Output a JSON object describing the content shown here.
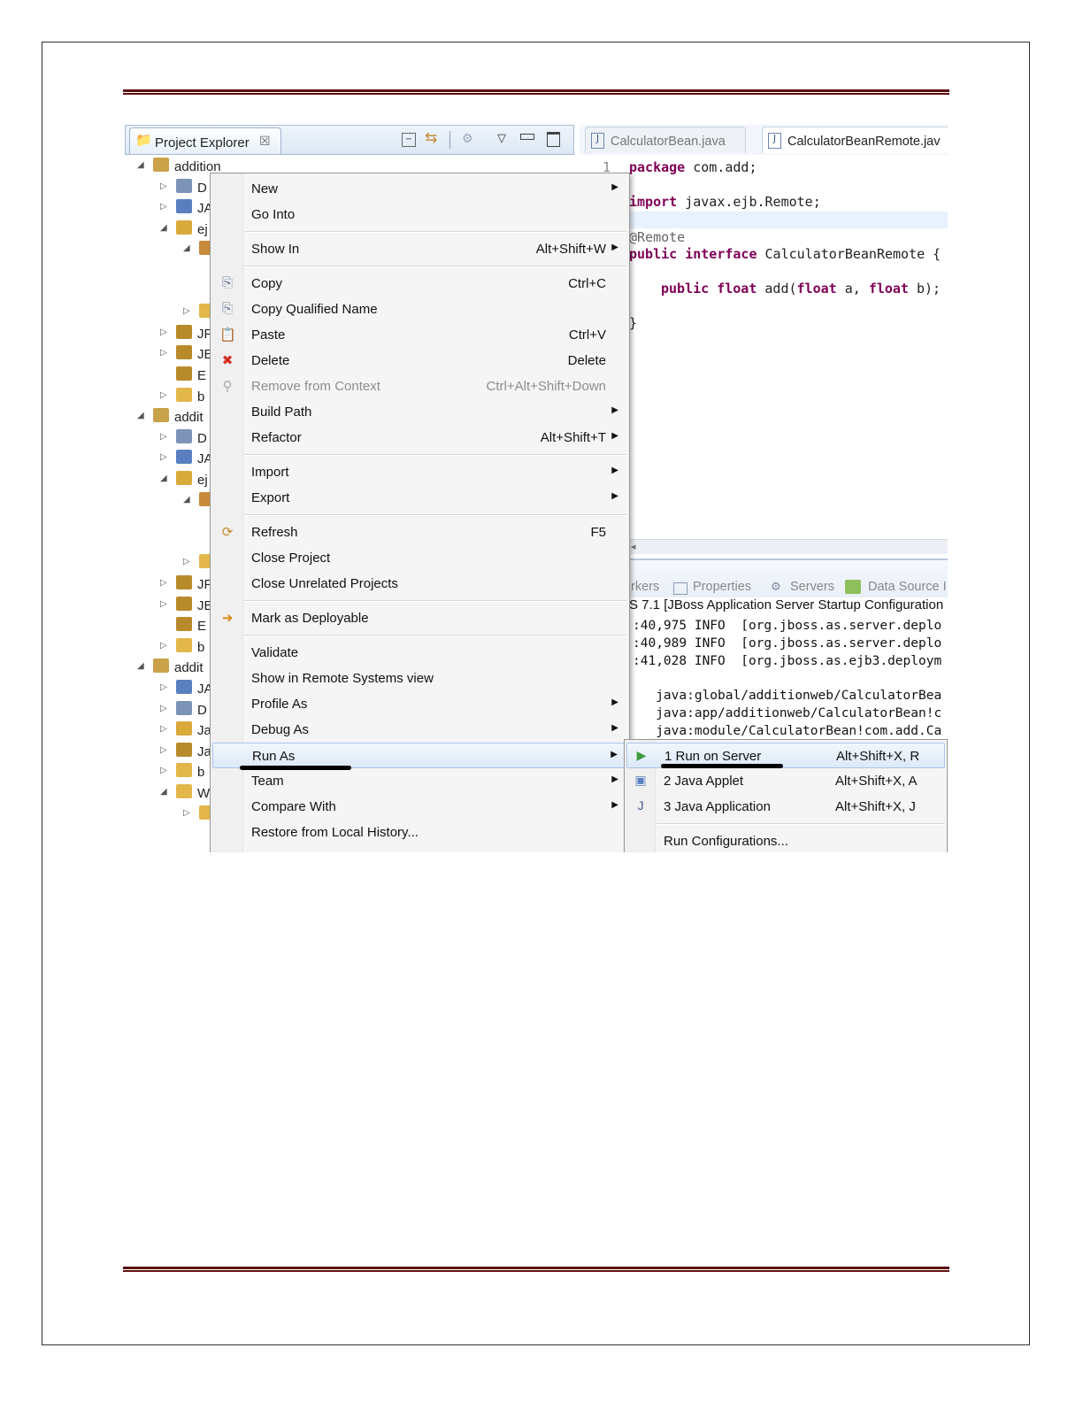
{
  "project_explorer": {
    "title": "Project Explorer",
    "close_glyph": "☒",
    "toolbar_icons": [
      "collapse-all-icon",
      "link-with-editor-icon",
      "filter-icon",
      "view-menu-icon",
      "minimize-icon",
      "maximize-icon"
    ]
  },
  "tree": [
    {
      "arrow": "◢",
      "label": "addition",
      "icon": "ejb-project-icon",
      "color": "#c9a24a",
      "indent": 0
    },
    {
      "arrow": "▷",
      "label": "D",
      "icon": "deployment-descriptor-icon",
      "color": "#7d93b8",
      "indent": 1
    },
    {
      "arrow": "▷",
      "label": "JA",
      "icon": "jax-ws-icon",
      "color": "#5a7fc0",
      "indent": 1
    },
    {
      "arrow": "◢",
      "label": "ej",
      "icon": "ejb-module-icon",
      "color": "#d9a93a",
      "indent": 1
    },
    {
      "arrow": "◢",
      "label": "",
      "icon": "package-icon",
      "color": "#c88a3a",
      "indent": 2
    },
    {
      "arrow": "",
      "label": "",
      "icon": "",
      "color": "",
      "indent": 3
    },
    {
      "arrow": "",
      "label": "",
      "icon": "",
      "color": "",
      "indent": 3
    },
    {
      "arrow": "▷",
      "label": "",
      "icon": "folder-icon",
      "color": "#e3b74a",
      "indent": 2
    },
    {
      "arrow": "▷",
      "label": "JF",
      "icon": "library-icon",
      "color": "#b88a2a",
      "indent": 1
    },
    {
      "arrow": "▷",
      "label": "JE",
      "icon": "library-icon",
      "color": "#b88a2a",
      "indent": 1
    },
    {
      "arrow": "",
      "label": "E",
      "icon": "library-icon",
      "color": "#b88a2a",
      "indent": 1
    },
    {
      "arrow": "▷",
      "label": "b",
      "icon": "folder-icon",
      "color": "#e3b74a",
      "indent": 1
    },
    {
      "arrow": "◢",
      "label": "addit",
      "icon": "ejb-project-icon",
      "color": "#c9a24a",
      "indent": 0
    },
    {
      "arrow": "▷",
      "label": "D",
      "icon": "deployment-descriptor-icon",
      "color": "#7d93b8",
      "indent": 1
    },
    {
      "arrow": "▷",
      "label": "JA",
      "icon": "jax-ws-icon",
      "color": "#5a7fc0",
      "indent": 1
    },
    {
      "arrow": "◢",
      "label": "ej",
      "icon": "ejb-module-icon",
      "color": "#d9a93a",
      "indent": 1
    },
    {
      "arrow": "◢",
      "label": "",
      "icon": "package-icon",
      "color": "#c88a3a",
      "indent": 2
    },
    {
      "arrow": "",
      "label": "",
      "icon": "",
      "color": "",
      "indent": 3
    },
    {
      "arrow": "",
      "label": "",
      "icon": "",
      "color": "",
      "indent": 3
    },
    {
      "arrow": "▷",
      "label": "",
      "icon": "folder-icon",
      "color": "#e3b74a",
      "indent": 2
    },
    {
      "arrow": "▷",
      "label": "JF",
      "icon": "library-icon",
      "color": "#b88a2a",
      "indent": 1
    },
    {
      "arrow": "▷",
      "label": "JE",
      "icon": "library-icon",
      "color": "#b88a2a",
      "indent": 1
    },
    {
      "arrow": "",
      "label": "E",
      "icon": "library-icon",
      "color": "#b88a2a",
      "indent": 1
    },
    {
      "arrow": "▷",
      "label": "b",
      "icon": "folder-icon",
      "color": "#e3b74a",
      "indent": 1
    },
    {
      "arrow": "◢",
      "label": "addit",
      "icon": "web-project-icon",
      "color": "#c9a24a",
      "indent": 0
    },
    {
      "arrow": "▷",
      "label": "JA",
      "icon": "jax-ws-icon",
      "color": "#5a7fc0",
      "indent": 1
    },
    {
      "arrow": "▷",
      "label": "D",
      "icon": "deployment-descriptor-icon",
      "color": "#7d93b8",
      "indent": 1
    },
    {
      "arrow": "▷",
      "label": "Ja",
      "icon": "java-resources-icon",
      "color": "#d9a93a",
      "indent": 1
    },
    {
      "arrow": "▷",
      "label": "Ja",
      "icon": "library-icon",
      "color": "#b88a2a",
      "indent": 1
    },
    {
      "arrow": "▷",
      "label": "b",
      "icon": "folder-icon",
      "color": "#e3b74a",
      "indent": 1
    },
    {
      "arrow": "◢",
      "label": "W",
      "icon": "folder-icon",
      "color": "#e3b74a",
      "indent": 1
    },
    {
      "arrow": "▷",
      "label": "",
      "icon": "folder-icon",
      "color": "#e3b74a",
      "indent": 2
    }
  ],
  "editor": {
    "tabs": [
      {
        "label": "CalculatorBean.java",
        "icon": "java-file-icon",
        "active": false
      },
      {
        "label": "CalculatorBeanRemote.jav",
        "icon": "java-file-icon",
        "active": true
      }
    ],
    "line_number": "1",
    "lines": [
      {
        "kw": "package",
        "rest": " com.add;"
      },
      {
        "kw": "import",
        "rest": " javax.ejb.Remote;"
      },
      {
        "ann": "@Remote",
        "rest": ""
      },
      {
        "kw": "public interface",
        "rest": " CalculatorBeanRemote {"
      },
      {
        "kw": "public float",
        "rest": " add(",
        "kw2": "float",
        "rest2": " a, ",
        "kw3": "float",
        "rest3": " b);"
      },
      {
        "rest": "}"
      }
    ]
  },
  "scroll_marker": "◂",
  "console": {
    "tabs": [
      "rkers",
      "Properties",
      "Servers",
      "Data Source I"
    ],
    "title": "S 7.1 [JBoss Application Server Startup Configuration",
    "lines": [
      ":40,975 INFO  [org.jboss.as.server.deplo",
      ":40,989 INFO  [org.jboss.as.server.deplo",
      ":41,028 INFO  [org.jboss.as.ejb3.deploym",
      "",
      "   java:global/additionweb/CalculatorBea",
      "   java:app/additionweb/CalculatorBean!c",
      "   java:module/CalculatorBean!com.add.Ca"
    ]
  },
  "context_menu": {
    "items": [
      {
        "label": "New",
        "shortcut": "",
        "submenu": true,
        "icon": "",
        "disabled": false
      },
      {
        "label": "Go Into",
        "shortcut": "",
        "submenu": false,
        "icon": "",
        "disabled": false
      },
      {
        "sep": true
      },
      {
        "label": "Show In",
        "shortcut": "Alt+Shift+W",
        "submenu": true,
        "icon": "",
        "disabled": false
      },
      {
        "sep": true
      },
      {
        "label": "Copy",
        "shortcut": "Ctrl+C",
        "submenu": false,
        "icon": "copy-icon",
        "disabled": false
      },
      {
        "label": "Copy Qualified Name",
        "shortcut": "",
        "submenu": false,
        "icon": "copy-qualified-name-icon",
        "disabled": false
      },
      {
        "label": "Paste",
        "shortcut": "Ctrl+V",
        "submenu": false,
        "icon": "paste-icon",
        "disabled": false
      },
      {
        "label": "Delete",
        "shortcut": "Delete",
        "submenu": false,
        "icon": "delete-icon",
        "disabled": false
      },
      {
        "label": "Remove from Context",
        "shortcut": "Ctrl+Alt+Shift+Down",
        "submenu": false,
        "icon": "remove-context-icon",
        "disabled": true
      },
      {
        "label": "Build Path",
        "shortcut": "",
        "submenu": true,
        "icon": "",
        "disabled": false
      },
      {
        "label": "Refactor",
        "shortcut": "Alt+Shift+T",
        "submenu": true,
        "icon": "",
        "disabled": false
      },
      {
        "sep": true
      },
      {
        "label": "Import",
        "shortcut": "",
        "submenu": true,
        "icon": "",
        "disabled": false
      },
      {
        "label": "Export",
        "shortcut": "",
        "submenu": true,
        "icon": "",
        "disabled": false
      },
      {
        "sep": true
      },
      {
        "label": "Refresh",
        "shortcut": "F5",
        "submenu": false,
        "icon": "refresh-icon",
        "disabled": false
      },
      {
        "label": "Close Project",
        "shortcut": "",
        "submenu": false,
        "icon": "",
        "disabled": false
      },
      {
        "label": "Close Unrelated Projects",
        "shortcut": "",
        "submenu": false,
        "icon": "",
        "disabled": false
      },
      {
        "sep": true
      },
      {
        "label": "Mark as Deployable",
        "shortcut": "",
        "submenu": false,
        "icon": "deployable-icon",
        "disabled": false
      },
      {
        "sep": true
      },
      {
        "label": "Validate",
        "shortcut": "",
        "submenu": false,
        "icon": "",
        "disabled": false
      },
      {
        "label": "Show in Remote Systems view",
        "shortcut": "",
        "submenu": false,
        "icon": "",
        "disabled": false
      },
      {
        "label": "Profile As",
        "shortcut": "",
        "submenu": true,
        "icon": "",
        "disabled": false
      },
      {
        "label": "Debug As",
        "shortcut": "",
        "submenu": true,
        "icon": "",
        "disabled": false
      },
      {
        "label": "Run As",
        "shortcut": "",
        "submenu": true,
        "icon": "",
        "disabled": false,
        "hover": true
      },
      {
        "label": "Team",
        "shortcut": "",
        "submenu": true,
        "icon": "",
        "disabled": false
      },
      {
        "label": "Compare With",
        "shortcut": "",
        "submenu": true,
        "icon": "",
        "disabled": false
      },
      {
        "label": "Restore from Local History...",
        "shortcut": "",
        "submenu": false,
        "icon": "",
        "disabled": false
      }
    ]
  },
  "run_as_submenu": {
    "items": [
      {
        "label": "1 Run on Server",
        "shortcut": "Alt+Shift+X, R",
        "icon": "run-on-server-icon",
        "hover": true
      },
      {
        "label": "2 Java Applet",
        "shortcut": "Alt+Shift+X, A",
        "icon": "java-applet-icon"
      },
      {
        "label": "3 Java Application",
        "shortcut": "Alt+Shift+X, J",
        "icon": "java-application-icon"
      },
      {
        "sep": true
      },
      {
        "label": "Run Configurations...",
        "shortcut": "",
        "icon": ""
      }
    ]
  },
  "colors": {
    "rule": "#5b1010",
    "keyword": "#7f0055",
    "menu_hover": "#dde9f8",
    "underline": "#000000"
  }
}
